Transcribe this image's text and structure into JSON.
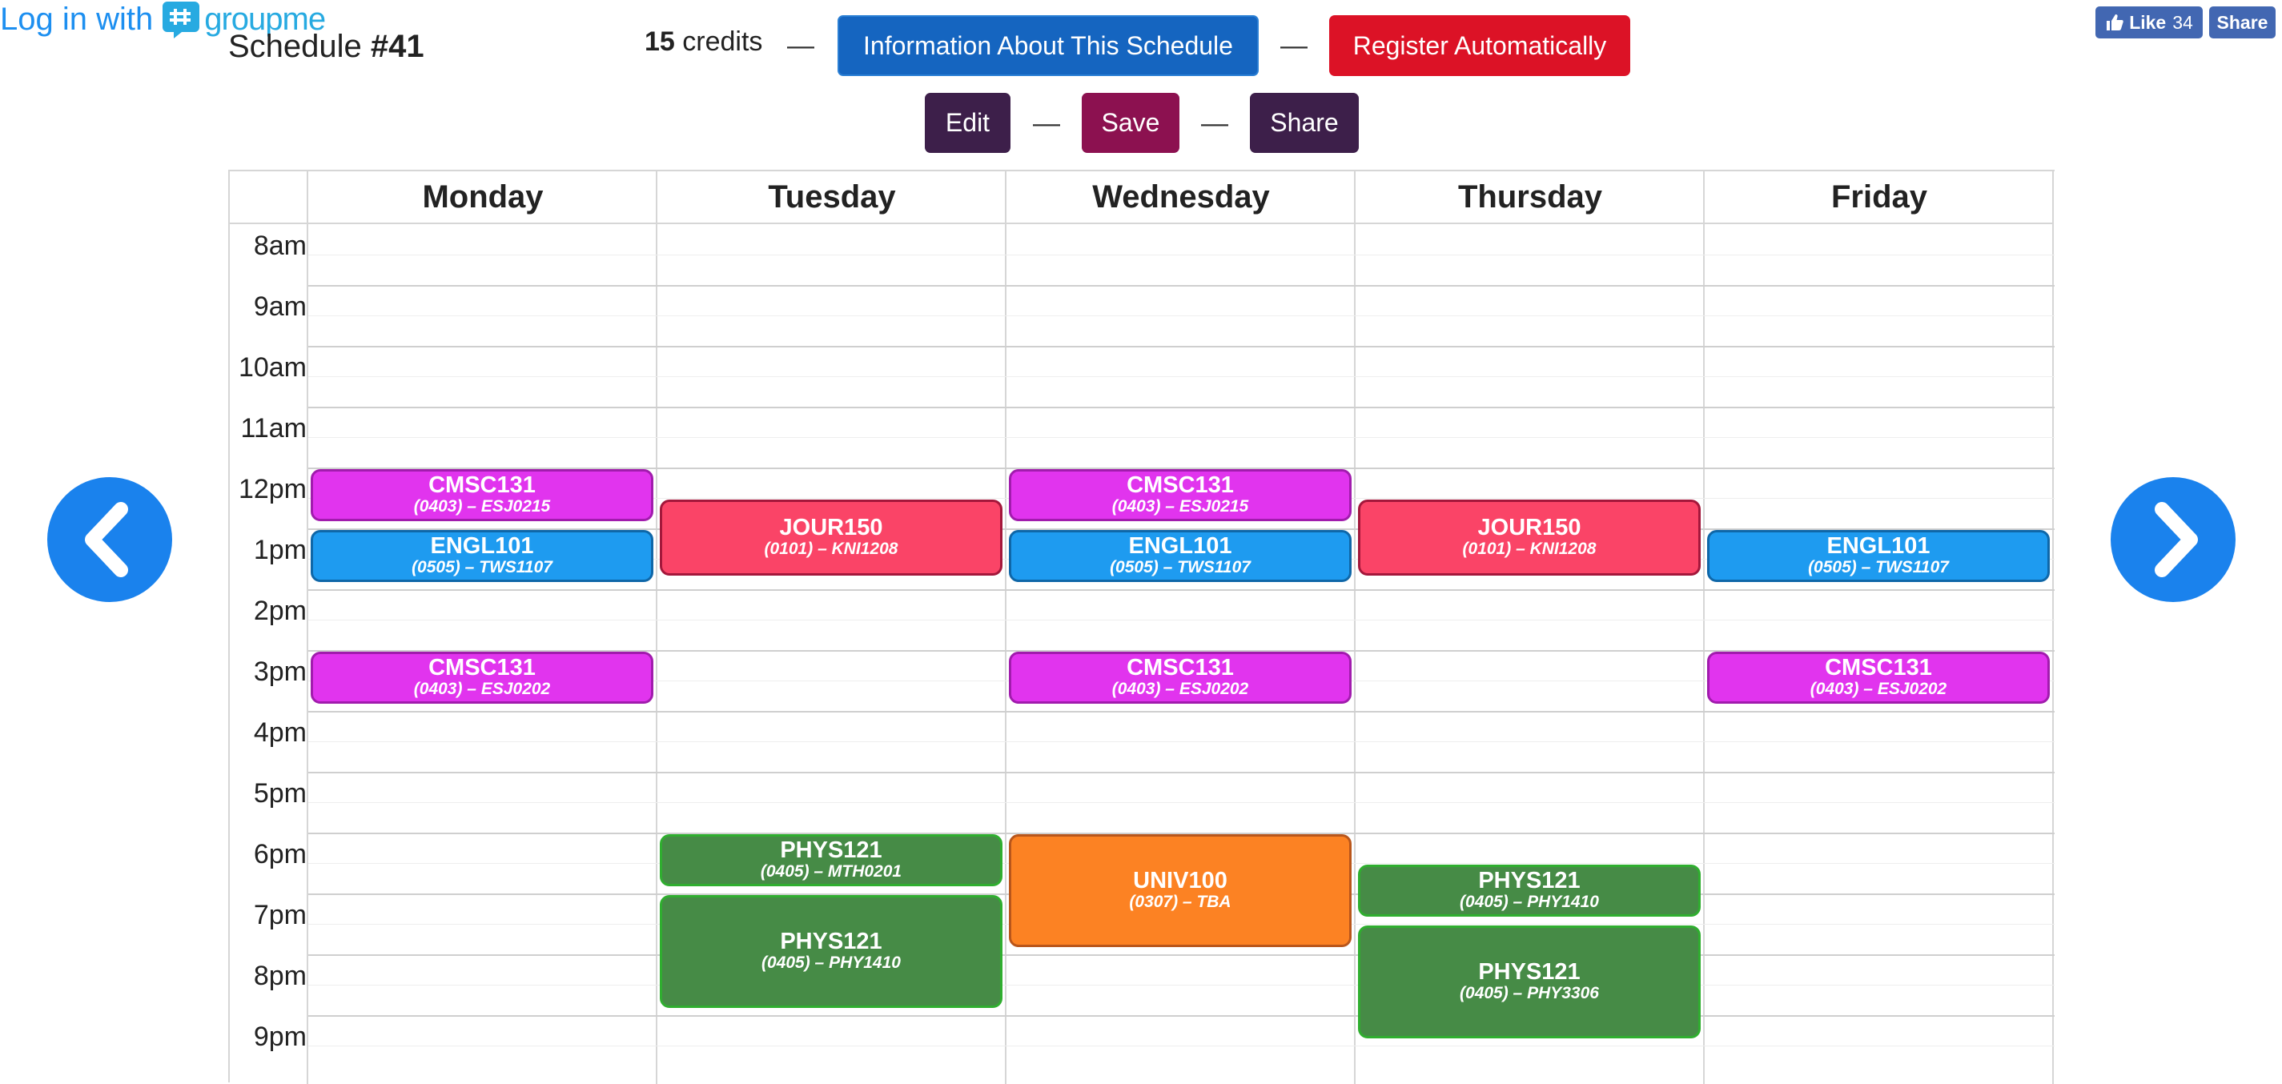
{
  "header": {
    "title_prefix": "Schedule ",
    "title_number": "#41",
    "credits_number": "15",
    "credits_label": " credits",
    "dash": "—",
    "info_button": "Information About This Schedule",
    "register_button": "Register Automatically",
    "login_text": "Log in with",
    "groupme_text": "groupme",
    "facebook": {
      "like_label": "Like",
      "like_count": "34",
      "share_label": "Share"
    }
  },
  "toolbar": {
    "edit": "Edit",
    "save": "Save",
    "share": "Share"
  },
  "calendar": {
    "days": [
      "Monday",
      "Tuesday",
      "Wednesday",
      "Thursday",
      "Friday"
    ],
    "hours": [
      "8am",
      "9am",
      "10am",
      "11am",
      "12pm",
      "1pm",
      "2pm",
      "3pm",
      "4pm",
      "5pm",
      "6pm",
      "7pm",
      "8pm",
      "9pm"
    ],
    "events": [
      {
        "day": 0,
        "start": 12.0,
        "end": 12.85,
        "code": "CMSC131",
        "section": "(0403) – ESJ0215",
        "color": "purple"
      },
      {
        "day": 0,
        "start": 13.0,
        "end": 13.85,
        "code": "ENGL101",
        "section": "(0505) – TWS1107",
        "color": "blue"
      },
      {
        "day": 0,
        "start": 15.0,
        "end": 15.85,
        "code": "CMSC131",
        "section": "(0403) – ESJ0202",
        "color": "purple"
      },
      {
        "day": 1,
        "start": 12.5,
        "end": 13.75,
        "code": "JOUR150",
        "section": "(0101) – KNI1208",
        "color": "red"
      },
      {
        "day": 1,
        "start": 18.0,
        "end": 18.85,
        "code": "PHYS121",
        "section": "(0405) – MTH0201",
        "color": "green"
      },
      {
        "day": 1,
        "start": 19.0,
        "end": 20.85,
        "code": "PHYS121",
        "section": "(0405) – PHY1410",
        "color": "green"
      },
      {
        "day": 2,
        "start": 12.0,
        "end": 12.85,
        "code": "CMSC131",
        "section": "(0403) – ESJ0215",
        "color": "purple"
      },
      {
        "day": 2,
        "start": 13.0,
        "end": 13.85,
        "code": "ENGL101",
        "section": "(0505) – TWS1107",
        "color": "blue"
      },
      {
        "day": 2,
        "start": 15.0,
        "end": 15.85,
        "code": "CMSC131",
        "section": "(0403) – ESJ0202",
        "color": "purple"
      },
      {
        "day": 2,
        "start": 18.0,
        "end": 19.85,
        "code": "UNIV100",
        "section": "(0307) – TBA",
        "color": "orange"
      },
      {
        "day": 3,
        "start": 12.5,
        "end": 13.75,
        "code": "JOUR150",
        "section": "(0101) – KNI1208",
        "color": "red"
      },
      {
        "day": 3,
        "start": 18.5,
        "end": 19.35,
        "code": "PHYS121",
        "section": "(0405) – PHY1410",
        "color": "green"
      },
      {
        "day": 3,
        "start": 19.5,
        "end": 21.35,
        "code": "PHYS121",
        "section": "(0405) – PHY3306",
        "color": "green"
      },
      {
        "day": 4,
        "start": 13.0,
        "end": 13.85,
        "code": "ENGL101",
        "section": "(0505) – TWS1107",
        "color": "blue"
      },
      {
        "day": 4,
        "start": 15.0,
        "end": 15.85,
        "code": "CMSC131",
        "section": "(0403) – ESJ0202",
        "color": "purple"
      }
    ]
  },
  "colors": {
    "purple": {
      "bg": "#e134ee",
      "border": "#a11cad"
    },
    "blue": {
      "bg": "#1e9bf0",
      "border": "#0f67a8"
    },
    "red": {
      "bg": "#fa4467",
      "border": "#a3173b"
    },
    "green": {
      "bg": "#468b46",
      "border": "#2fae2f"
    },
    "orange": {
      "bg": "#fc8223",
      "border": "#b9561b"
    },
    "info_button": "#1565c0",
    "register_button": "#dc1226",
    "edit_button": "#3d1f4a",
    "save_button": "#8c1150",
    "share_button": "#3d1f4a",
    "nav_arrow": "#1a82ed"
  },
  "nav": {
    "prev_icon": "chevron-left-icon",
    "next_icon": "chevron-right-icon"
  }
}
